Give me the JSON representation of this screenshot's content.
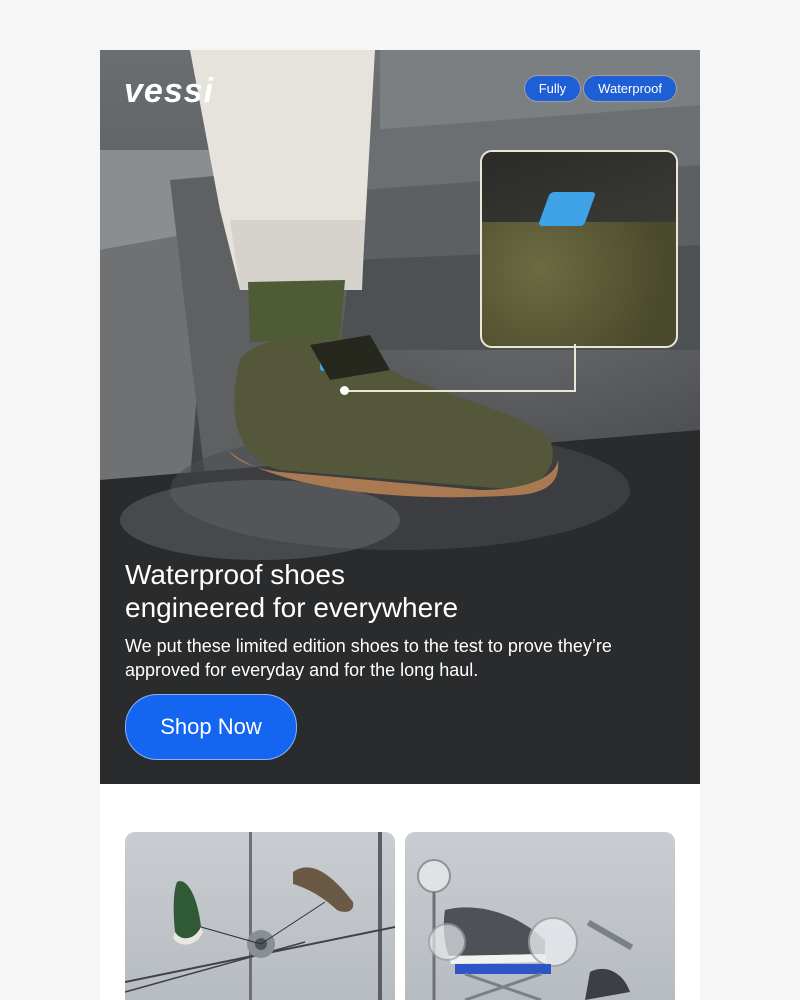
{
  "brand": {
    "logo_text": "vessi"
  },
  "hero": {
    "badges": [
      "Fully",
      "Waterproof"
    ],
    "title_line1": "Waterproof shoes",
    "title_line2": "engineered for everywhere",
    "subtitle": "We put these limited edition shoes to the test to prove they’re approved for everyday and for the long haul.",
    "cta_label": "Shop Now"
  },
  "colors": {
    "accent": "#1466f0",
    "badge": "#1f5fd6",
    "page_bg": "#f6f6f6"
  },
  "icons": {
    "hero_image": "shoe-splash-photo",
    "tile_left": "hanging-shoes-photo",
    "tile_right": "shoe-on-lab-stand-photo"
  }
}
